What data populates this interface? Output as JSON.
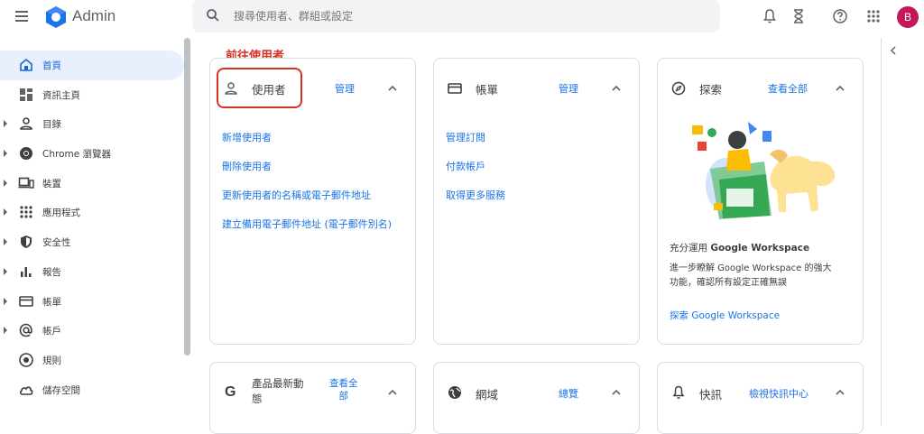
{
  "topbar": {
    "app_name": "Admin",
    "search_placeholder": "搜尋使用者、群組或設定",
    "avatar_letter": "B"
  },
  "sidebar": {
    "items": [
      {
        "label": "首頁",
        "icon": "home-icon",
        "active": true,
        "caret": false
      },
      {
        "label": "資訊主頁",
        "icon": "dashboard-icon",
        "active": false,
        "caret": false
      },
      {
        "label": "目錄",
        "icon": "person-icon",
        "active": false,
        "caret": true
      },
      {
        "label": "Chrome 瀏覽器",
        "icon": "chrome-icon",
        "active": false,
        "caret": true
      },
      {
        "label": "裝置",
        "icon": "devices-icon",
        "active": false,
        "caret": true
      },
      {
        "label": "應用程式",
        "icon": "apps-grid-icon",
        "active": false,
        "caret": true
      },
      {
        "label": "安全性",
        "icon": "shield-icon",
        "active": false,
        "caret": true
      },
      {
        "label": "報告",
        "icon": "bar-chart-icon",
        "active": false,
        "caret": true
      },
      {
        "label": "帳單",
        "icon": "billing-card-icon",
        "active": false,
        "caret": true
      },
      {
        "label": "帳戶",
        "icon": "at-sign-icon",
        "active": false,
        "caret": true
      },
      {
        "label": "規則",
        "icon": "rules-icon",
        "active": false,
        "caret": false
      },
      {
        "label": "儲存空間",
        "icon": "cloud-icon",
        "active": false,
        "caret": false
      }
    ]
  },
  "annotation": "前往使用者",
  "cards": {
    "users": {
      "title": "使用者",
      "action": "管理",
      "links": [
        "新增使用者",
        "刪除使用者",
        "更新使用者的名稱或電子郵件地址",
        "建立備用電子郵件地址 (電子郵件別名)"
      ]
    },
    "billing": {
      "title": "帳單",
      "action": "管理",
      "links": [
        "管理訂閱",
        "付款帳戶",
        "取得更多服務"
      ]
    },
    "explore": {
      "title": "探索",
      "action": "查看全部",
      "heading_prefix": "充分運用",
      "heading_brand": "Google Workspace",
      "desc_line1": "進一步瞭解 Google Workspace 的強大",
      "desc_line2": "功能，確認所有設定正確無誤",
      "link": "探索 Google Workspace"
    },
    "updates": {
      "title_line1": "產品最新動",
      "title_line2": "態",
      "action_line1": "查看全",
      "action_line2": "部"
    },
    "domains": {
      "title": "網域",
      "action": "總覽"
    },
    "alerts": {
      "title": "快訊",
      "action": "檢視快訊中心"
    }
  }
}
